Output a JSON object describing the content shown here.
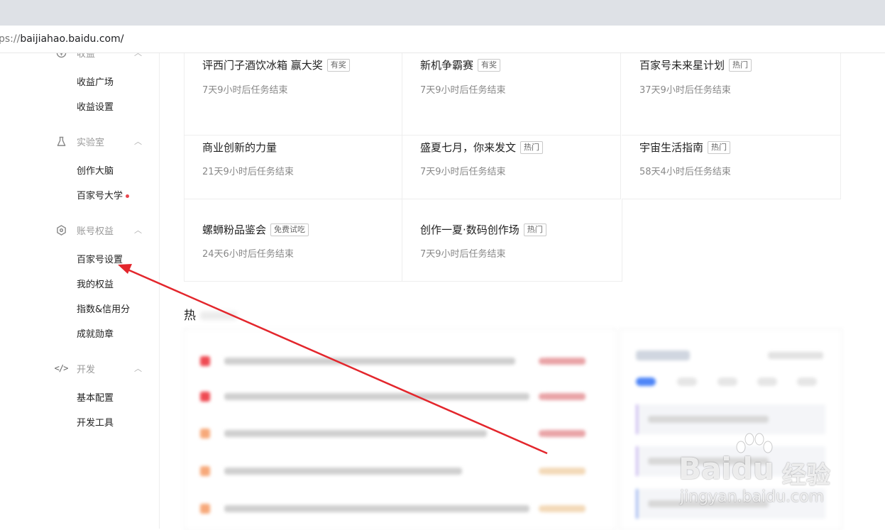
{
  "browser": {
    "url_scheme": "ps://",
    "url_host": "baijiahao.baidu.com/"
  },
  "sidebar": {
    "groups": [
      {
        "label": "收益",
        "icon": "revenue-icon",
        "items": [
          "收益广场",
          "收益设置"
        ]
      },
      {
        "label": "实验室",
        "icon": "lab-flask-icon",
        "items": [
          "创作大脑",
          "百家号大学"
        ]
      },
      {
        "label": "账号权益",
        "icon": "hexagon-settings-icon",
        "items": [
          "百家号设置",
          "我的权益",
          "指数&信用分",
          "成就勋章"
        ]
      },
      {
        "label": "开发",
        "icon": "code-icon",
        "items": [
          "基本配置",
          "开发工具"
        ]
      }
    ]
  },
  "tasks": [
    {
      "title": "评西门子酒饮冰箱 赢大奖",
      "tag": "有奖",
      "deadline": "7天9小时后任务结束"
    },
    {
      "title": "新机争霸赛",
      "tag": "有奖",
      "deadline": "7天9小时后任务结束"
    },
    {
      "title": "百家号未来星计划",
      "tag": "热门",
      "deadline": "37天9小时后任务结束"
    },
    {
      "title": "商业创新的力量",
      "tag": "",
      "deadline": "21天9小时后任务结束"
    },
    {
      "title": "盛夏七月，你来发文",
      "tag": "热门",
      "deadline": "7天9小时后任务结束"
    },
    {
      "title": "宇宙生活指南",
      "tag": "热门",
      "deadline": "58天4小时后任务结束"
    },
    {
      "title": "螺蛳粉品鉴会",
      "tag": "免费试吃",
      "deadline": "24天6小时后任务结束"
    },
    {
      "title": "创作一夏·数码创作场",
      "tag": "热门",
      "deadline": "7天9小时后任务结束"
    }
  ],
  "hot_section_label": "热",
  "watermark": {
    "brand": "Baidu",
    "product": "经验",
    "url": "jingyan.baidu.com"
  },
  "colors": {
    "accent_red": "#e3262c",
    "hot_badge": "#ef4a52",
    "warm_badge": "#f7a97a"
  }
}
